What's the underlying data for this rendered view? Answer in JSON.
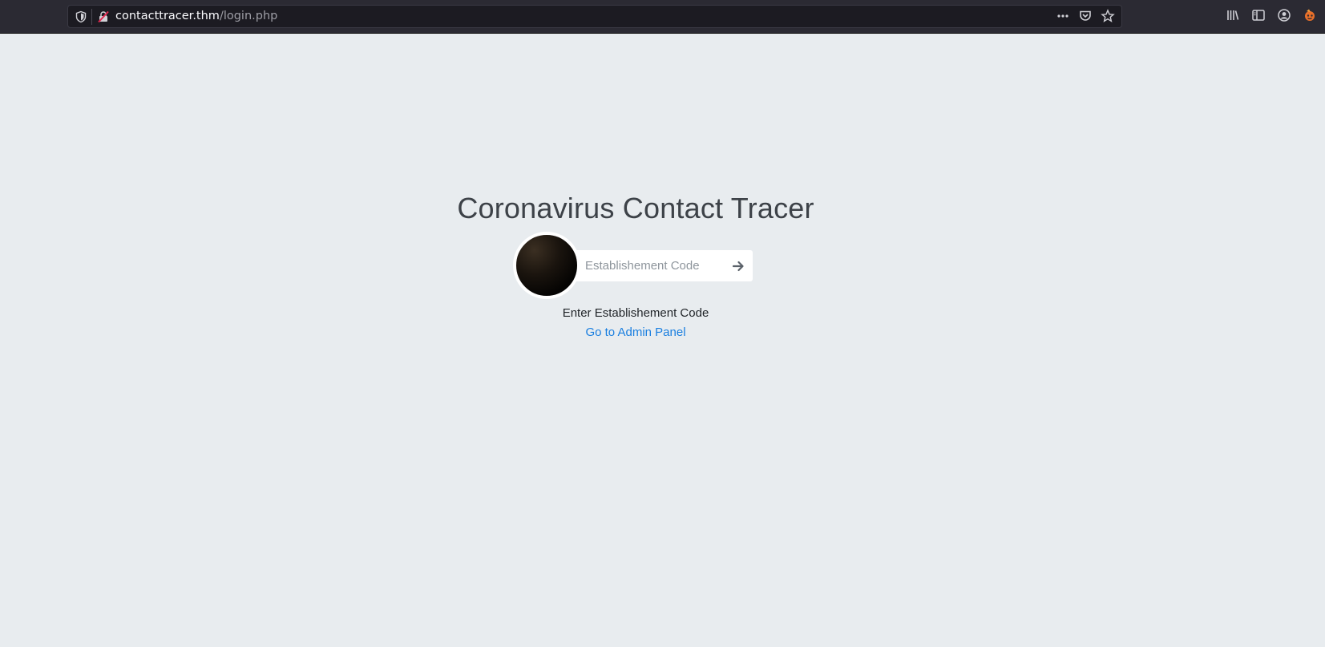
{
  "browser": {
    "url_host": "contacttracer.thm",
    "url_path": "/login.php",
    "icons": [
      "tracking-shield-icon",
      "insecure-lock-icon",
      "more-actions-icon",
      "pocket-icon",
      "bookmark-star-icon",
      "library-icon",
      "sidebar-icon",
      "account-icon",
      "extension-icon"
    ]
  },
  "page": {
    "title": "Coronavirus Contact Tracer",
    "code_input": {
      "placeholder": "Establishement Code",
      "value": ""
    },
    "hint": "Enter Establishement Code",
    "admin_link": "Go to Admin Panel"
  },
  "colors": {
    "background": "#e8ecef",
    "link": "#1a7fe0",
    "toolbar": "#2b2a33"
  }
}
